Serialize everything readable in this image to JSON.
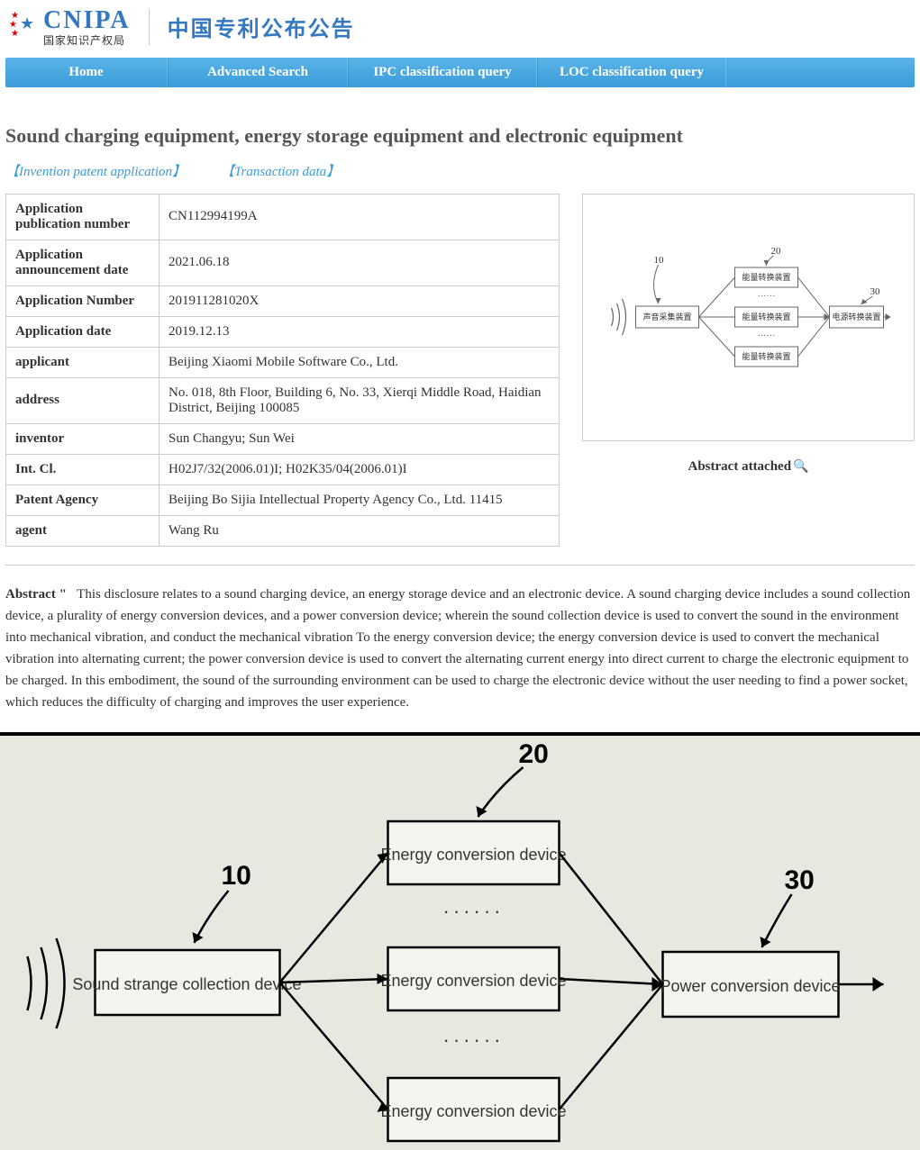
{
  "header": {
    "logo_abbr": "CNIPA",
    "logo_sub": "国家知识产权局",
    "site_title": "中国专利公布公告"
  },
  "nav": {
    "items": [
      {
        "label": "Home"
      },
      {
        "label": "Advanced Search"
      },
      {
        "label": "IPC classification query"
      },
      {
        "label": "LOC classification query"
      }
    ]
  },
  "page": {
    "title": "Sound charging equipment, energy storage equipment and electronic equipment"
  },
  "tabs": [
    {
      "label": "Invention patent application"
    },
    {
      "label": "Transaction data"
    }
  ],
  "table": [
    {
      "label": "Application publication number",
      "value": "CN112994199A"
    },
    {
      "label": "Application announcement date",
      "value": "2021.06.18"
    },
    {
      "label": "Application Number",
      "value": "201911281020X"
    },
    {
      "label": "Application date",
      "value": "2019.12.13"
    },
    {
      "label": "applicant",
      "value": "Beijing Xiaomi Mobile Software Co., Ltd."
    },
    {
      "label": "address",
      "value": "No. 018, 8th Floor, Building 6, No. 33, Xierqi Middle Road, Haidian District, Beijing 100085"
    },
    {
      "label": "inventor",
      "value": "Sun Changyu; Sun Wei"
    },
    {
      "label": "Int. Cl.",
      "value": "H02J7/32(2006.01)I; H02K35/04(2006.01)I"
    },
    {
      "label": "Patent Agency",
      "value": "Beijing Bo Sijia Intellectual Property Agency Co., Ltd. 11415"
    },
    {
      "label": "agent",
      "value": "Wang Ru"
    }
  ],
  "thumb": {
    "caption": "Abstract attached",
    "boxes": {
      "left": "声音采集装置",
      "mid": "能量转换装置",
      "right": "电源转换装置"
    },
    "nums": {
      "a": "10",
      "b": "20",
      "c": "30"
    }
  },
  "abstract": {
    "label": "Abstract \"",
    "text": "This disclosure relates to a sound charging device, an energy storage device and an electronic device. A sound charging device includes a sound collection device, a plurality of energy conversion devices, and a power conversion device; wherein the sound collection device is used to convert the sound in the environment into mechanical vibration, and conduct the mechanical vibration To the energy conversion device; the energy conversion device is used to convert the mechanical vibration into alternating current; the power conversion device is used to convert the alternating current energy into direct current to charge the electronic equipment to be charged. In this embodiment, the sound of the surrounding environment can be used to charge the electronic device without the user needing to find a power socket, which reduces the difficulty of charging and improves the user experience."
  },
  "diagram": {
    "nums": {
      "a": "10",
      "b": "20",
      "c": "30"
    },
    "boxes": {
      "left": "Sound strange collection device",
      "mid": "Energy conversion device",
      "right": "Power conversion device"
    },
    "dots": "······"
  }
}
